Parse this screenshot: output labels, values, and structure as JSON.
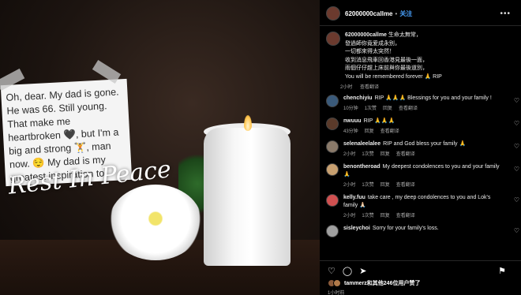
{
  "photo": {
    "note_text": "Oh, dear. My dad is gone. He was 66. Still young. That make me heartbroken 🖤, but I'm a big and strong 🏋, man now. 😌 My dad is my greatest inspiration to",
    "overlay_text": "Rest In Peace"
  },
  "post": {
    "username": "62000000callme",
    "follow_label": "关注",
    "more_icon": "more-horizontal-icon",
    "caption": {
      "username": "62000000callme",
      "text": "生命太無常，\n發過師你竟爱成永别，\n一切都來得太突然！\n收到消息飛車回香港見最後一面，\n雨個仔仔趕上床前與你最後道別，\nYou will be remembered forever 🙏 RIP",
      "time": "2小时",
      "translate": "查看翻译"
    },
    "comments": [
      {
        "username": "chenchiyiu",
        "text": "RIP 🙏🙏🙏 Blessings for you and your family !",
        "time": "10分钟",
        "likes": "1次赞",
        "reply": "回复",
        "translate": "查看翻译"
      },
      {
        "username": "nwuuu",
        "text": "RIP 🙏🙏🙏",
        "time": "43分钟",
        "likes": "",
        "reply": "回复",
        "translate": "查看翻译"
      },
      {
        "username": "selenaleelalee",
        "text": "RIP and God bless your family 🙏",
        "time": "2小时",
        "likes": "1次赞",
        "reply": "回复",
        "translate": "查看翻译"
      },
      {
        "username": "benontheroad",
        "text": "My deepest condolences to you and your family 🙏",
        "time": "2小时",
        "likes": "1次赞",
        "reply": "回复",
        "translate": "查看翻译"
      },
      {
        "username": "kelly.fuu",
        "text": "take care , my deep condolences to you and Lok's family 🙏🏻",
        "time": "2小时",
        "likes": "1次赞",
        "reply": "回复",
        "translate": "查看翻译"
      },
      {
        "username": "sisleychoi",
        "text": "Sorry for your family's loss.",
        "time": "",
        "likes": "",
        "reply": "",
        "translate": ""
      }
    ],
    "likes_text": "tammerz和其他246位用户赞了",
    "time_ago": "1小时前"
  }
}
